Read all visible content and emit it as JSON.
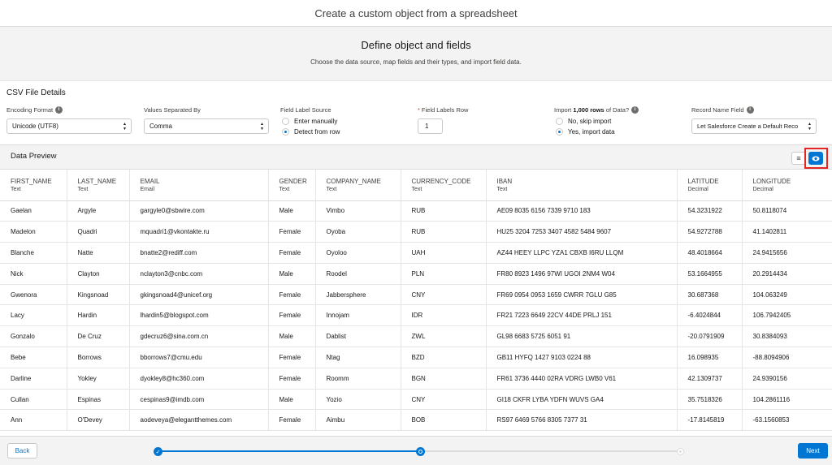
{
  "header": {
    "title": "Create a custom object from a spreadsheet"
  },
  "step": {
    "heading": "Define object and fields",
    "subtitle": "Choose the data source, map fields and their types, and import field data."
  },
  "csv": {
    "title": "CSV File Details",
    "encoding": {
      "label": "Encoding Format",
      "value": "Unicode (UTF8)"
    },
    "separator": {
      "label": "Values Separated By",
      "value": "Comma"
    },
    "label_source": {
      "label": "Field Label Source",
      "options": [
        "Enter manually",
        "Detect from row"
      ],
      "selected": "Detect from row"
    },
    "labels_row": {
      "label": "Field Labels Row",
      "value": "1"
    },
    "import": {
      "label_prefix": "Import ",
      "label_bold": "1,000 rows",
      "label_suffix": " of Data?",
      "options": [
        "No, skip import",
        "Yes, import data"
      ],
      "selected": "Yes, import data"
    },
    "record_name": {
      "label": "Record Name Field",
      "value": "Let Salesforce Create a Default Reco"
    }
  },
  "preview": {
    "title": "Data Preview",
    "list_icon": "list-icon",
    "view_icon": "eye-icon",
    "accent": "#0176d3",
    "highlight_color": "#e12424"
  },
  "table": {
    "columns": [
      {
        "name": "FIRST_NAME",
        "type": "Text"
      },
      {
        "name": "LAST_NAME",
        "type": "Text"
      },
      {
        "name": "EMAIL",
        "type": "Email"
      },
      {
        "name": "GENDER",
        "type": "Text"
      },
      {
        "name": "COMPANY_NAME",
        "type": "Text"
      },
      {
        "name": "CURRENCY_CODE",
        "type": "Text"
      },
      {
        "name": "IBAN",
        "type": "Text"
      },
      {
        "name": "LATITUDE",
        "type": "Decimal"
      },
      {
        "name": "LONGITUDE",
        "type": "Decimal"
      }
    ],
    "rows": [
      [
        "Gaelan",
        "Argyle",
        "gargyle0@sbwire.com",
        "Male",
        "Vimbo",
        "RUB",
        "AE09 8035 6156 7339 9710 183",
        "54.3231922",
        "50.8118074"
      ],
      [
        "Madelon",
        "Quadri",
        "mquadri1@vkontakte.ru",
        "Female",
        "Oyoba",
        "RUB",
        "HU25 3204 7253 3407 4582 5484 9607",
        "54.9272788",
        "41.1402811"
      ],
      [
        "Blanche",
        "Natte",
        "bnatte2@rediff.com",
        "Female",
        "Oyoloo",
        "UAH",
        "AZ44 HEEY LLPC YZA1 CBXB I6RU LLQM",
        "48.4018664",
        "24.9415656"
      ],
      [
        "Nick",
        "Clayton",
        "nclayton3@cnbc.com",
        "Male",
        "Roodel",
        "PLN",
        "FR80 8923 1496 97WI UGOI 2NM4 W04",
        "53.1664955",
        "20.2914434"
      ],
      [
        "Gwenora",
        "Kingsnoad",
        "gkingsnoad4@unicef.org",
        "Female",
        "Jabbersphere",
        "CNY",
        "FR69 0954 0953 1659 CWRR 7GLU G85",
        "30.687368",
        "104.063249"
      ],
      [
        "Lacy",
        "Hardin",
        "lhardin5@blogspot.com",
        "Female",
        "Innojam",
        "IDR",
        "FR21 7223 6649 22CV 44DE PRLJ 151",
        "-6.4024844",
        "106.7942405"
      ],
      [
        "Gonzalo",
        "De Cruz",
        "gdecruz6@sina.com.cn",
        "Male",
        "Dablist",
        "ZWL",
        "GL98 6683 5725 6051 91",
        "-20.0791909",
        "30.8384093"
      ],
      [
        "Bebe",
        "Borrows",
        "bborrows7@cmu.edu",
        "Female",
        "Ntag",
        "BZD",
        "GB11 HYFQ 1427 9103 0224 88",
        "16.098935",
        "-88.8094906"
      ],
      [
        "Darline",
        "Yokley",
        "dyokley8@hc360.com",
        "Female",
        "Roomm",
        "BGN",
        "FR61 3736 4440 02RA VDRG LWB0 V61",
        "42.1309737",
        "24.9390156"
      ],
      [
        "Cullan",
        "Espinas",
        "cespinas9@imdb.com",
        "Male",
        "Yozio",
        "CNY",
        "GI18 CKFR LYBA YDFN WUVS GA4",
        "35.7518326",
        "104.2861116"
      ],
      [
        "Ann",
        "O'Devey",
        "aodeveya@elegantthemes.com",
        "Female",
        "Aimbu",
        "BOB",
        "RS97 6469 5766 8305 7377 31",
        "-17.8145819",
        "-63.1560853"
      ]
    ]
  },
  "footer": {
    "back_label": "Back",
    "next_label": "Next",
    "check_icon": "check-icon"
  }
}
